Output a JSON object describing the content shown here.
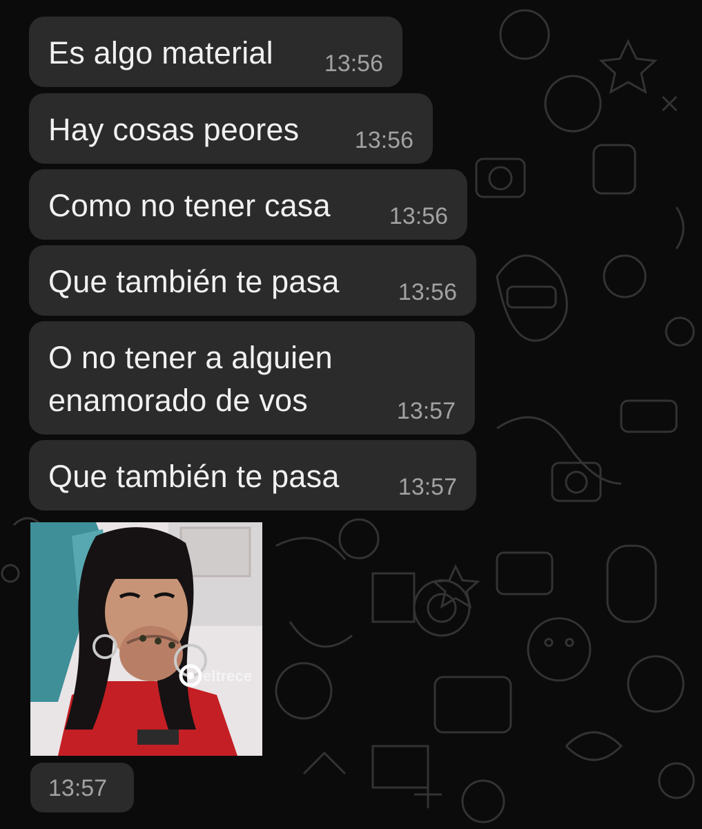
{
  "messages": [
    {
      "text": "Es algo material",
      "time": "13:56"
    },
    {
      "text": "Hay cosas peores",
      "time": "13:56"
    },
    {
      "text": "Como no tener casa",
      "time": "13:56"
    },
    {
      "text": "Que también te pasa",
      "time": "13:56"
    },
    {
      "line1": "O no tener a alguien",
      "line2": "enamorado de vos",
      "time": "13:57"
    },
    {
      "text": "Que también te pasa",
      "time": "13:57"
    }
  ],
  "sticker": {
    "watermark": "eltrece",
    "time": "13:57"
  },
  "colors": {
    "background": "#0b0b0b",
    "bubble": "#2b2b2c",
    "text": "#f1f1f1",
    "timestamp": "#a2a2a2"
  }
}
